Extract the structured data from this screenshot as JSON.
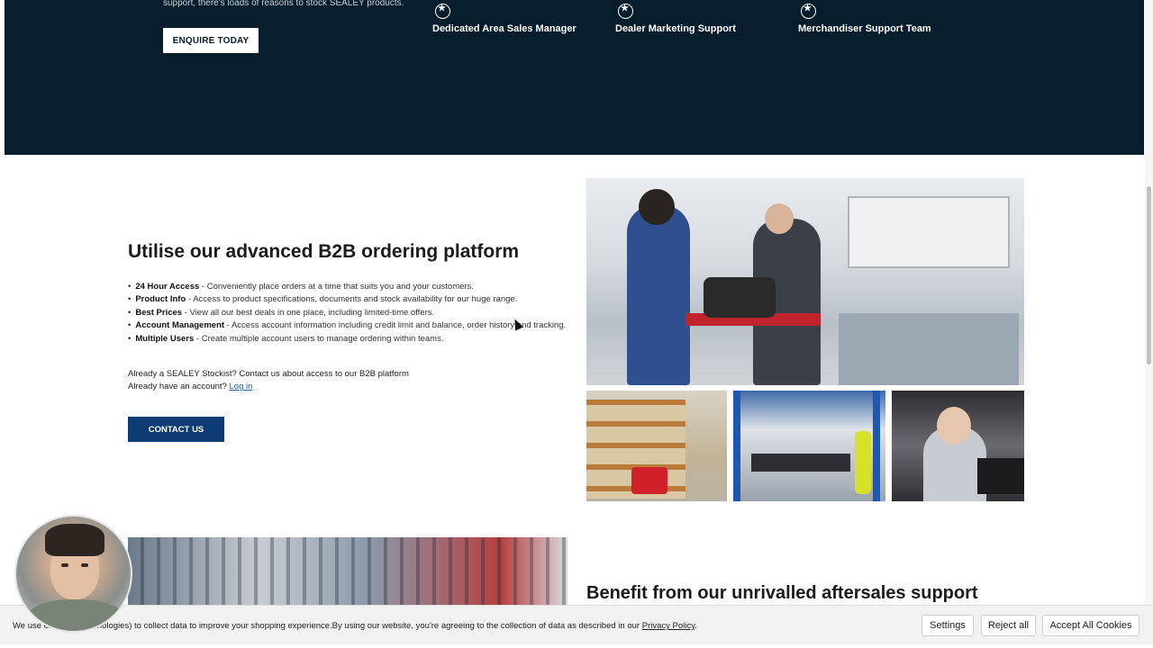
{
  "hero": {
    "intro_text": "support, there's loads of reasons to stock SEALEY products.",
    "enquire_label": "ENQUIRE TODAY",
    "features": [
      {
        "label": "Dedicated Area Sales Manager",
        "icon": "badge-icon"
      },
      {
        "label": "Dealer Marketing Support",
        "icon": "badge-icon"
      },
      {
        "label": "Merchandiser Support Team",
        "icon": "badge-icon"
      }
    ]
  },
  "b2b": {
    "title": "Utilise our advanced B2B ordering platform",
    "items": [
      {
        "term": "24 Hour Access",
        "desc": " - Conveniently place orders at a time that suits you and your customers."
      },
      {
        "term": "Product Info",
        "desc": " - Access to product specifications, documents and stock availability for our huge range."
      },
      {
        "term": "Best Prices",
        "desc": " - View all our best deals in one place, including limited-time offers."
      },
      {
        "term": "Account Management",
        "desc": " - Access account information including credit limit and balance, order history and tracking."
      },
      {
        "term": "Multiple Users",
        "desc": " - Create multiple account users to manage ordering within teams."
      }
    ],
    "stockist_text": "Already a SEALEY Stockist? Contact us about access to our B2B platform",
    "account_prefix": "Already have an account? ",
    "login_label": "Log in",
    "contact_label": "CONTACT US"
  },
  "aftersales": {
    "title": "Benefit from our unrivalled aftersales support"
  },
  "cookie": {
    "text_prefix": "We use ",
    "text_body": "er similar technologies) to collect data to improve your shopping experience.By using our website, you're agreeing to the collection of data as described in our ",
    "privacy_label": "Privacy Policy",
    "text_suffix": ".",
    "settings_label": "Settings",
    "reject_label": "Reject all",
    "accept_label": "Accept All Cookies"
  },
  "colors": {
    "hero_bg": "#061d2c",
    "primary_button": "#0d3b73",
    "link": "#1a5aa0"
  }
}
